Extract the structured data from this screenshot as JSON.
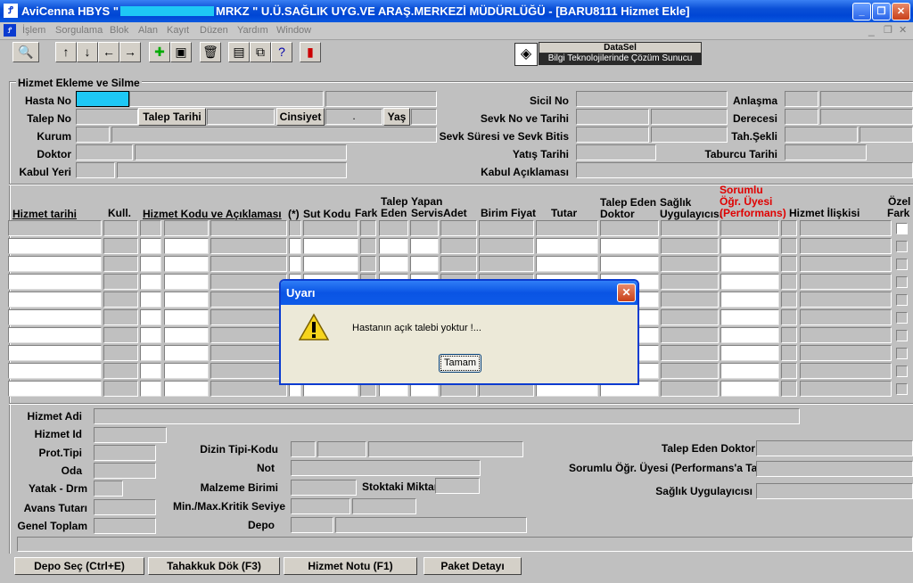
{
  "window": {
    "title_prefix": "AviCenna HBYS \"",
    "title_suffix": "MRKZ \" U.Ü.SAĞLIK UYG.VE ARAŞ.MERKEZİ MÜDÜRLÜĞÜ - [BARU8111 Hizmet Ekle]",
    "redaction_color": "#1ec8f5",
    "buttons": {
      "minimize": "_",
      "restore": "❐",
      "close": "✕"
    }
  },
  "menu": [
    "İşlem",
    "Sorgulama",
    "Blok",
    "Alan",
    "Kayıt",
    "Düzen",
    "Yardım",
    "Window"
  ],
  "toolbar_icons": [
    "search-icon",
    "arrow-up-icon",
    "arrow-down-icon",
    "arrow-left-icon",
    "arrow-right-icon",
    "add-record-icon",
    "save-icon",
    "delete-icon",
    "print-icon",
    "copy-icon",
    "help-icon",
    "exit-icon"
  ],
  "datasel": {
    "name": "DataSel",
    "tagline": "Bilgi Teknolojilerinde Çözüm Sunucu"
  },
  "section_title": "Hizmet Ekleme ve Silme",
  "patient": {
    "hasta_no_label": "Hasta No",
    "talep_no_label": "Talep No",
    "talep_tarihi_label": "Talep Tarihi",
    "cinsiyet_label": "Cinsiyet",
    "yas_label": "Yaş",
    "kurum_label": "Kurum",
    "doktor_label": "Doktor",
    "kabul_yeri_label": "Kabul Yeri",
    "sicil_no_label": "Sicil No",
    "sevk_no_label": "Sevk No ve Tarihi",
    "sevk_suresi_label": "Sevk Süresi ve Sevk Bitis",
    "yatis_label": "Yatış Tarihi",
    "kabul_aciklamasi_label": "Kabul Açıklaması",
    "anlasma_label": "Anlaşma",
    "derecesi_label": "Derecesi",
    "tah_sekli_label": "Tah.Şekli",
    "taburcu_label": "Taburcu Tarihi",
    "cinsiyet_value": "."
  },
  "grid": {
    "hizmet_tarihi": "Hizmet tarihi",
    "kull": "Kull.",
    "hizmet_kodu": "Hizmet Kodu ve Açıklaması",
    "star": "(*)",
    "sut_kodu": "Sut Kodu",
    "fark": "Fark",
    "talep_eden_1": "Talep",
    "talep_eden_2": "Eden",
    "yapan_1": "Yapan",
    "yapan_2": "Servis",
    "adet": "Adet",
    "birim_fiyat": "Birim Fiyat",
    "tutar": "Tutar",
    "talep_eden_doktor_1": "Talep Eden",
    "talep_eden_doktor_2": "Doktor",
    "saglik_1": "Sağlık",
    "saglik_2": "Uygulayıcısı",
    "sorumlu_1": "Sorumlu",
    "sorumlu_2": "Öğr. Üyesi",
    "sorumlu_3": "(Performans)",
    "hizmet_iliskisi": "Hizmet İlişkisi",
    "ozel_1": "Özel",
    "ozel_2": "Fark",
    "sorumlu_color": "#e00000"
  },
  "details": {
    "hizmet_adi": "Hizmet Adi",
    "hizmet_id": "Hizmet Id",
    "prot_tipi": "Prot.Tipi",
    "oda": "Oda",
    "yatak": "Yatak - Drm",
    "avans": "Avans Tutarı",
    "genel_toplam": "Genel Toplam",
    "dizin_tipi": "Dizin Tipi-Kodu",
    "not": "Not",
    "malzeme_birimi": "Malzeme Birimi",
    "stoktaki": "Stoktaki Miktarı",
    "min_max": "Min./Max.Kritik Seviye",
    "depo": "Depo",
    "talep_eden_doktor": "Talep Eden Doktor",
    "sorumlu": "Sorumlu Öğr. Üyesi (Performans'a Tabi)",
    "saglik": "Sağlık Uygulayıcısı"
  },
  "buttons": {
    "depo_sec": "Depo Seç (Ctrl+E)",
    "tahakkuk": "Tahakkuk Dök (F3)",
    "hizmet_notu": "Hizmet Notu (F1)",
    "paket": "Paket Detayı"
  },
  "dialog": {
    "title": "Uyarı",
    "message": "Hastanın açık talebi yoktur !...",
    "ok": "Tamam"
  }
}
